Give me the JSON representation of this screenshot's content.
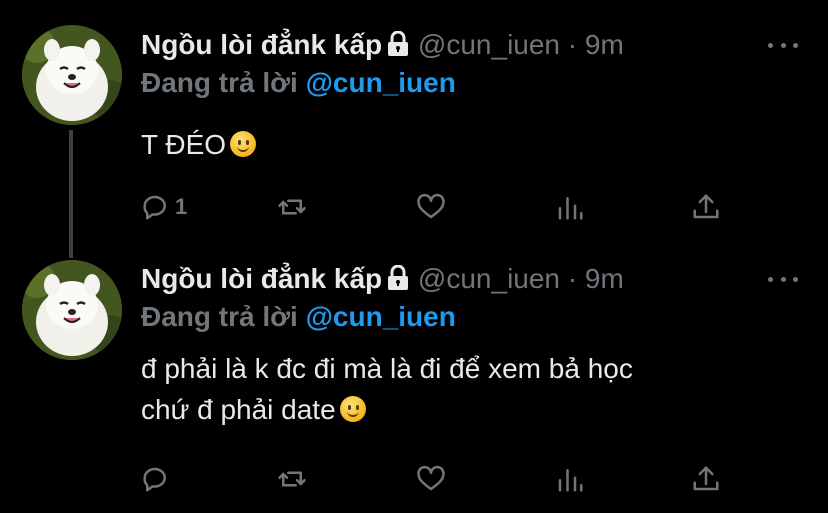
{
  "tweets": [
    {
      "display_name": "Ngồu lòi đẳnk kấp",
      "handle": "@cun_iuen",
      "separator": "·",
      "time": "9m",
      "reply_prefix": "Đang trả lời",
      "reply_to": "@cun_iuen",
      "text": "T ĐÉO",
      "reply_count": "1",
      "retweet_count": "",
      "like_count": ""
    },
    {
      "display_name": "Ngồu lòi đẳnk kấp",
      "handle": "@cun_iuen",
      "separator": "·",
      "time": "9m",
      "reply_prefix": "Đang trả lời",
      "reply_to": "@cun_iuen",
      "text_line1": "đ phải là k đc đi mà là đi để xem bả học",
      "text_line2": "chứ đ phải date",
      "reply_count": "",
      "retweet_count": "",
      "like_count": ""
    }
  ],
  "icons": {
    "reply": "reply-icon",
    "retweet": "retweet-icon",
    "like": "heart-icon",
    "views": "analytics-icon",
    "share": "share-icon",
    "lock": "lock-icon",
    "more": "more-icon",
    "emoji": "slightly-smiling-face"
  },
  "colors": {
    "background": "#000000",
    "text": "#e7e9ea",
    "muted": "#71767b",
    "link": "#1d9bf0",
    "thread_line": "#3e4144"
  }
}
